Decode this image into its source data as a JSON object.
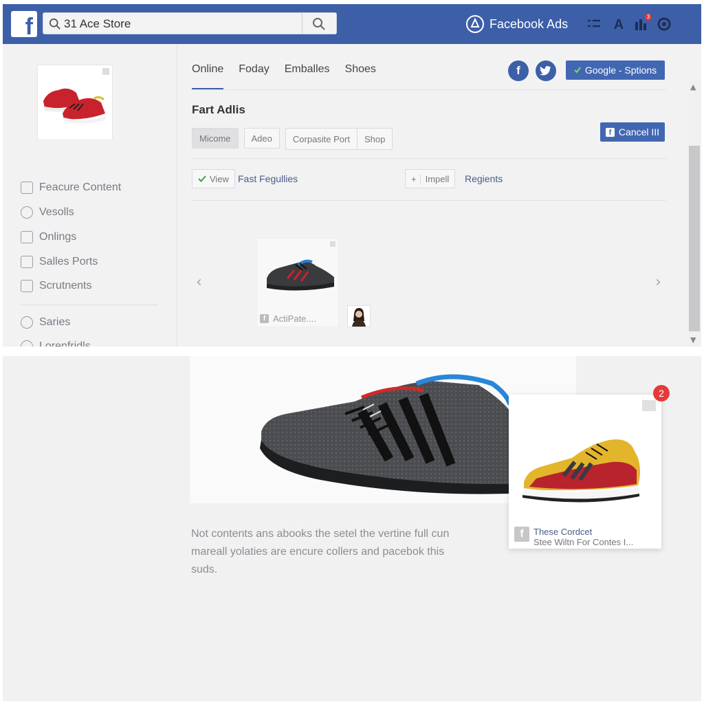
{
  "header": {
    "search_value": "31 Ace Store",
    "ads_label": "Facebook Ads",
    "notification_count": "3"
  },
  "sidebar": {
    "items": [
      {
        "label": "Feacure Content",
        "icon": "store-icon"
      },
      {
        "label": "Vesolls",
        "icon": "target-icon"
      },
      {
        "label": "Onlings",
        "icon": "card-icon"
      },
      {
        "label": "Salles Ports",
        "icon": "chart-icon"
      },
      {
        "label": "Scrutnents",
        "icon": "puzzle-icon"
      },
      {
        "label": "Saries",
        "icon": "clock-icon"
      },
      {
        "label": "Lorenfridls",
        "icon": "globe-icon"
      }
    ]
  },
  "tabs": [
    "Online",
    "Foday",
    "Emballes",
    "Shoes"
  ],
  "google_button": "Google - Sptions",
  "section_title": "Fart Adlis",
  "cancel_button": "Cancel III",
  "chips": [
    "Micome",
    "Adeo",
    "Corpasite Port",
    "Shop"
  ],
  "filters": {
    "view": "View",
    "fast_link": "Fast Fegullies",
    "impell": "Impell",
    "regients": "Regients"
  },
  "carousel": {
    "card_caption": "ActiPate...."
  },
  "lower": {
    "description": "Not contents ans abooks the setel the vertine full cun mareall yolaties are encure collers and pacebok this suds.",
    "popup_badge": "2",
    "popup_title": "These Cordcet",
    "popup_sub": "Stee Wiltn For Contes I..."
  },
  "colors": {
    "brand_blue": "#3c5fa8",
    "button_blue": "#4267b2",
    "badge_red": "#e63a3a"
  }
}
